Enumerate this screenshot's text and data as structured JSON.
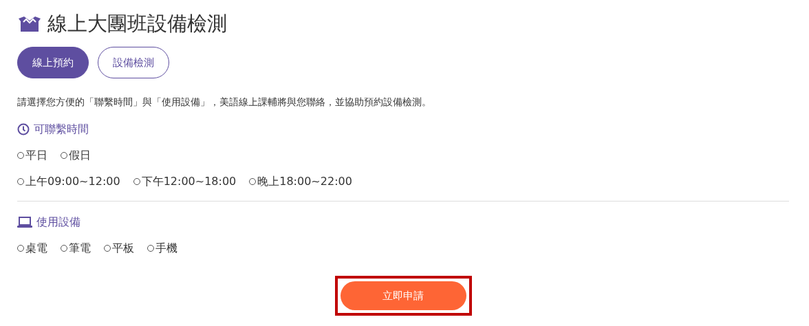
{
  "title": "線上大團班設備檢測",
  "tabs": [
    {
      "label": "線上預約",
      "selected": true
    },
    {
      "label": "設備檢測",
      "selected": false
    }
  ],
  "description": "請選擇您方便的「聯繫時間」與「使用設備」，美語線上課輔將與您聯絡，並協助預約設備檢測。",
  "sections": [
    {
      "kind": "clock",
      "heading": "可聯繫時間",
      "option_rows": [
        [
          {
            "label": "平日",
            "selected": false
          },
          {
            "label": "假日",
            "selected": false
          }
        ],
        [
          {
            "label": "上午09:00~12:00",
            "selected": false
          },
          {
            "label": "下午12:00~18:00",
            "selected": false
          },
          {
            "label": "晚上18:00~22:00",
            "selected": false
          }
        ]
      ]
    },
    {
      "kind": "laptop",
      "heading": "使用設備",
      "option_rows": [
        [
          {
            "label": "桌電",
            "selected": false
          },
          {
            "label": "筆電",
            "selected": false
          },
          {
            "label": "平板",
            "selected": false
          },
          {
            "label": "手機",
            "selected": false
          }
        ]
      ]
    }
  ],
  "submit": {
    "label": "立即申請",
    "highlighted": true
  }
}
